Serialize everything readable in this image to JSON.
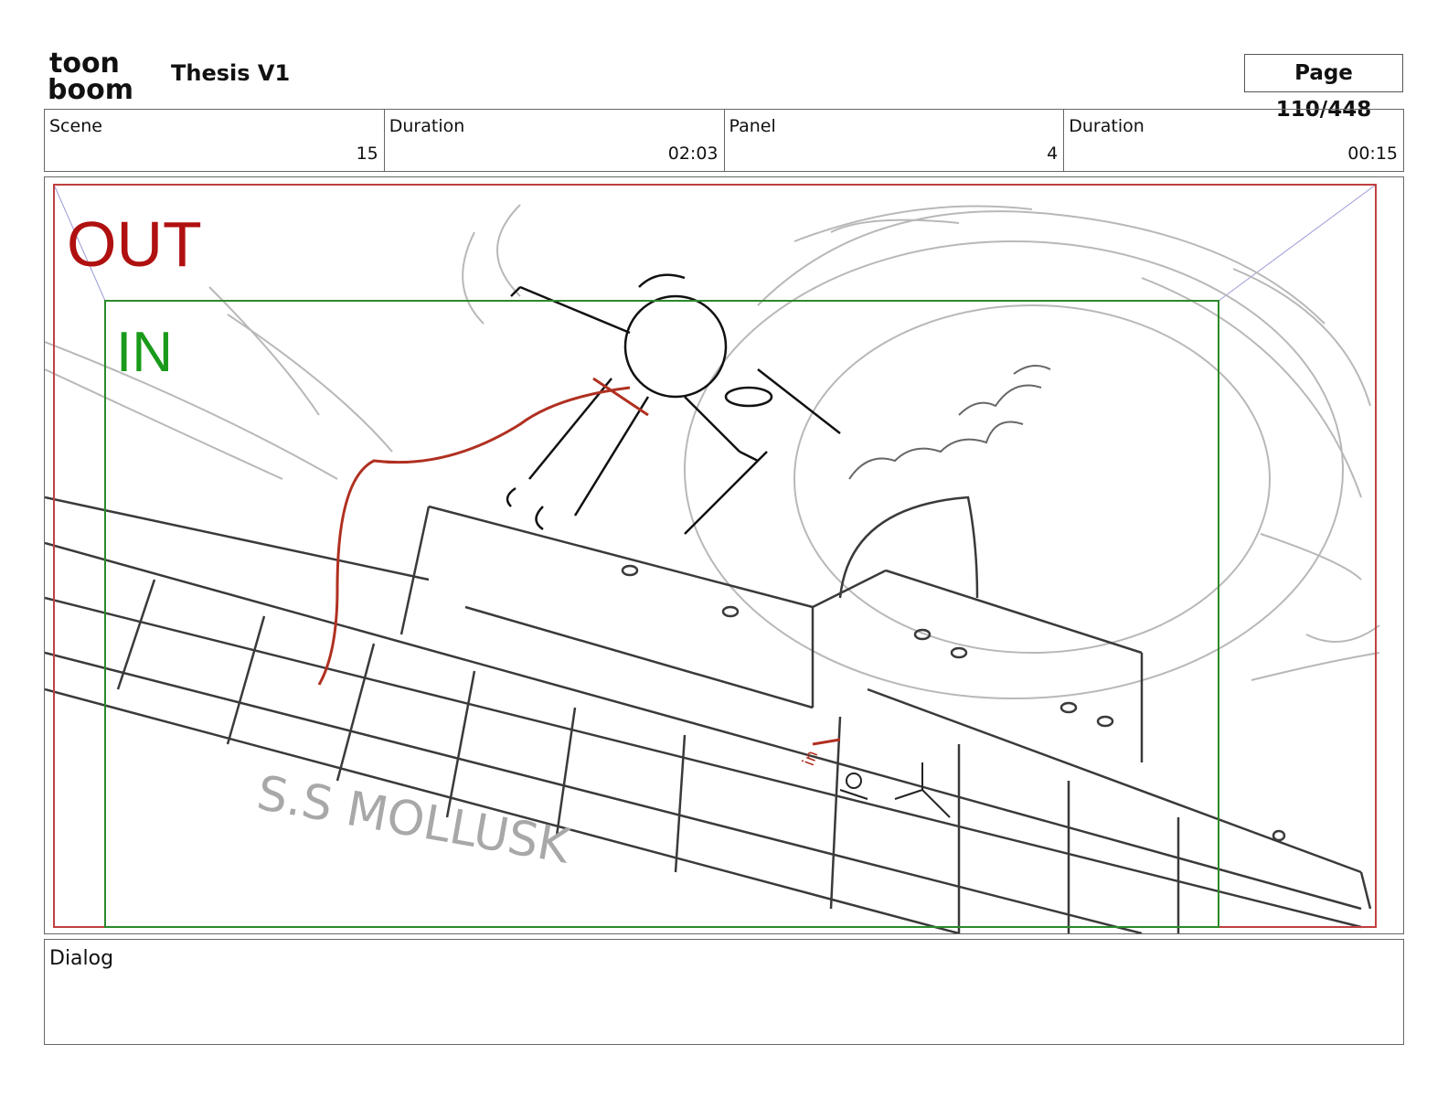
{
  "header": {
    "logo_line1": "toon",
    "logo_line2": "boom",
    "title": "Thesis V1",
    "page_label": "Page 110/448"
  },
  "info": [
    {
      "label": "Scene",
      "value": "15"
    },
    {
      "label": "Duration",
      "value": "02:03"
    },
    {
      "label": "Panel",
      "value": "4"
    },
    {
      "label": "Duration",
      "value": "00:15"
    }
  ],
  "panel": {
    "out_label": "OUT",
    "in_label": "IN",
    "ship_name": "S.S MOLLUSK",
    "in_note": "in",
    "out_color": "#b01010",
    "in_color": "#1a9a1a",
    "red_line_color": "#b03020"
  },
  "dialog": {
    "label": "Dialog",
    "text": ""
  }
}
